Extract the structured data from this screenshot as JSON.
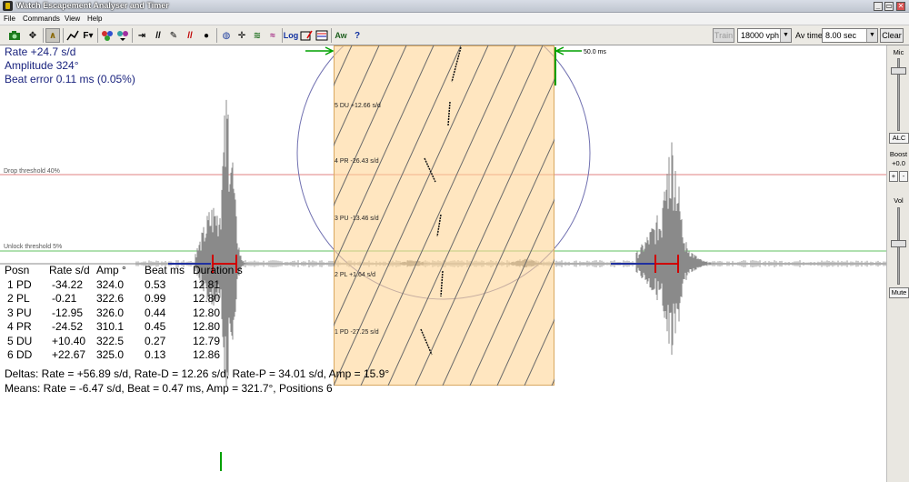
{
  "window": {
    "title": "Watch Escapement Analyser and Timer",
    "controls": [
      "_",
      "▭",
      "✕"
    ]
  },
  "menu": [
    "File",
    "Commands",
    "View",
    "Help"
  ],
  "toolbar": {
    "train_label": "Train",
    "vph_value": "18000 vph",
    "avtime_label": "Av time",
    "avtime_value": "8.00 sec",
    "clear_label": "Clear",
    "icons": [
      "camera-icon",
      "move-icon",
      "peak-icon",
      "graph-icon",
      "paint-filter-icon",
      "palette-icon",
      "palette-down-icon",
      "compress-icon",
      "slash-icon",
      "stylus-icon",
      "red-slash-icon",
      "drop-icon",
      "circle-icon",
      "expand-icon",
      "spectrum-icon",
      "wave-icon",
      "log-icon",
      "chart-edit-icon",
      "multi-chart-icon",
      "aw-icon",
      "help-icon"
    ],
    "log_label": "Log",
    "aw_label": "Aw"
  },
  "readout": {
    "rate": "Rate  +24.7 s/d",
    "amplitude": "Amplitude 324°",
    "beat_error": "Beat error 0.11 ms (0.05%)"
  },
  "thresholds": {
    "drop": "Drop threshold 40%",
    "unlock": "Unlock threshold 5%"
  },
  "table": {
    "headers": [
      "Posn",
      "Rate s/d",
      "Amp °",
      "Beat ms",
      "Duration s"
    ],
    "rows": [
      [
        "1 PD",
        "-34.22",
        "324.0",
        "0.53",
        "12.81"
      ],
      [
        "2 PL",
        "-0.21",
        "322.6",
        "0.99",
        "12.80"
      ],
      [
        "3 PU",
        "-12.95",
        "326.0",
        "0.44",
        "12.80"
      ],
      [
        "4 PR",
        "-24.52",
        "310.1",
        "0.45",
        "12.80"
      ],
      [
        "5 DU",
        "+10.40",
        "322.5",
        "0.27",
        "12.79"
      ],
      [
        "6 DD",
        "+22.67",
        "325.0",
        "0.13",
        "12.86"
      ]
    ]
  },
  "summary": {
    "deltas": "Deltas:  Rate = +56.89 s/d, Rate-D = 12.26 s/d, Rate-P = 34.01 s/d, Amp =  15.9°",
    "means": "Means:   Rate = -6.47 s/d, Beat = 0.47 ms, Amp = 321.7°, Positions 6"
  },
  "band": {
    "ms_label": "50.0 ms",
    "positions": [
      "5 DU  +12.66 s/d",
      "4 PR  -26.43 s/d",
      "3 PU  -13.46 s/d",
      "2 PL  +1.64 s/d",
      "1 PD  -27.25 s/d"
    ]
  },
  "right_panel": {
    "mic": "Mic",
    "alc": "ALC",
    "boost": "Boost",
    "boost_value": "+0.0",
    "plus": "+",
    "minus": "-",
    "vol": "Vol",
    "mute": "Mute"
  },
  "colors": {
    "readout": "#1a237e",
    "drop_line": "#e08080",
    "unlock_line": "#60c060",
    "band_fill": "#ffd696",
    "marker_red": "#d00000",
    "marker_green": "#00a000",
    "waveform": "#8a8a8a",
    "circle": "#7070b0"
  }
}
